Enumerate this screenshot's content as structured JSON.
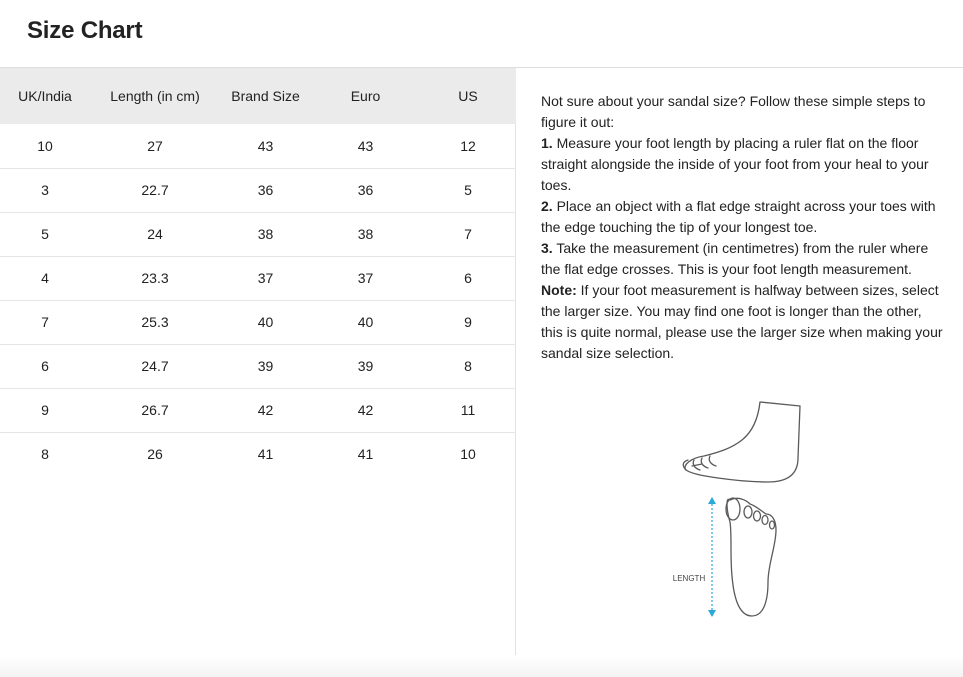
{
  "header": {
    "title": "Size Chart"
  },
  "table": {
    "columns": [
      "UK/India",
      "Length (in cm)",
      "Brand Size",
      "Euro",
      "US"
    ],
    "rows": [
      [
        "10",
        "27",
        "43",
        "43",
        "12"
      ],
      [
        "3",
        "22.7",
        "36",
        "36",
        "5"
      ],
      [
        "5",
        "24",
        "38",
        "38",
        "7"
      ],
      [
        "4",
        "23.3",
        "37",
        "37",
        "6"
      ],
      [
        "7",
        "25.3",
        "40",
        "40",
        "9"
      ],
      [
        "6",
        "24.7",
        "39",
        "39",
        "8"
      ],
      [
        "9",
        "26.7",
        "42",
        "42",
        "11"
      ],
      [
        "8",
        "26",
        "41",
        "41",
        "10"
      ]
    ]
  },
  "guide": {
    "intro": "Not sure about your sandal size? Follow these simple steps to figure it out:",
    "step1_num": "1.",
    "step1_text": " Measure your foot length by placing a ruler flat on the floor straight alongside the inside of your foot from your heal to your toes.",
    "step2_num": "2.",
    "step2_text": " Place an object with a flat edge straight across your toes with the edge touching the tip of your longest toe.",
    "step3_num": "3.",
    "step3_text": " Take the measurement (in centimetres) from the ruler where the flat edge crosses. This is your foot length measurement.",
    "note_label": "Note:",
    "note_text": " If your foot measurement is halfway between sizes, select the larger size. You may find one foot is longer than the other, this is quite normal, please use the larger size when making your sandal size selection."
  },
  "figure": {
    "length_label": "LENGTH",
    "line_color": "#5a5a5a",
    "measure_color": "#2aa8d8"
  }
}
